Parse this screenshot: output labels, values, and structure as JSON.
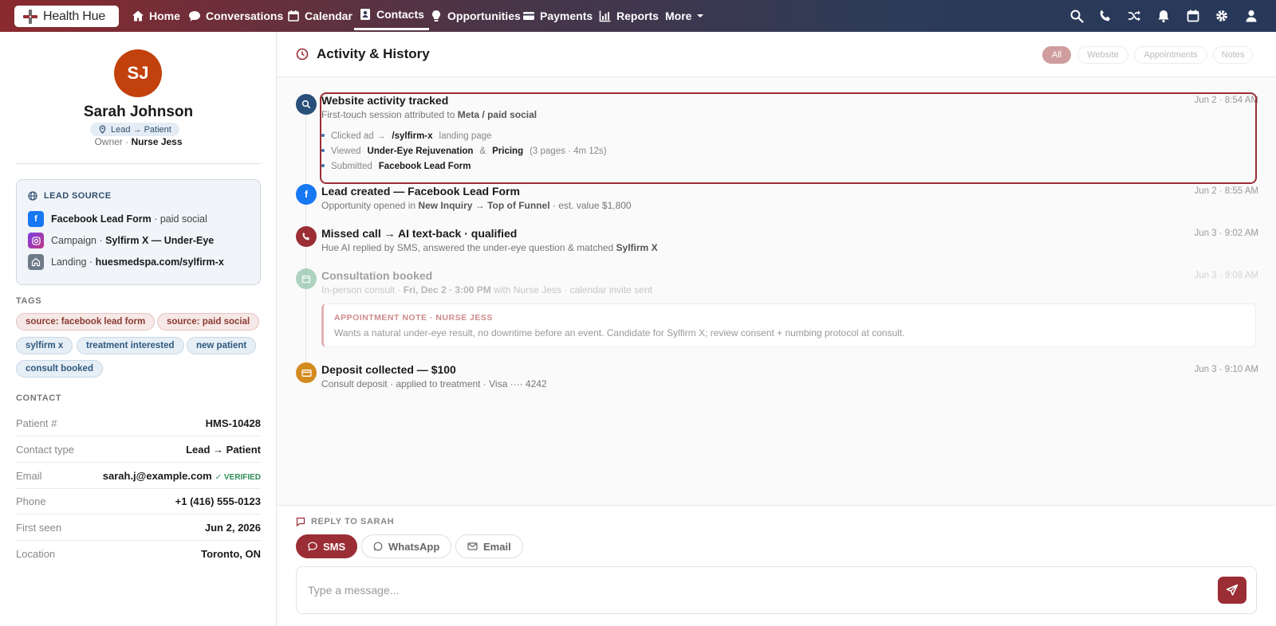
{
  "brand": {
    "name": "Health Hue",
    "accent": "#9b2d35"
  },
  "nav": {
    "items": [
      {
        "label": "Home",
        "icon": "home-icon"
      },
      {
        "label": "Conversations",
        "icon": "chat-icon"
      },
      {
        "label": "Calendar",
        "icon": "calendar-icon"
      },
      {
        "label": "Contacts",
        "icon": "contacts-icon",
        "active": true
      },
      {
        "label": "Opportunities",
        "icon": "bulb-icon"
      },
      {
        "label": "Payments",
        "icon": "card-icon"
      },
      {
        "label": "Reports",
        "icon": "chart-icon"
      },
      {
        "label": "More",
        "icon": "chevron-down-icon"
      }
    ],
    "right_icons": [
      "search-icon",
      "phone-icon",
      "shuffle-icon",
      "bell-icon",
      "calendar-icon",
      "gear-icon",
      "user-icon"
    ]
  },
  "contact": {
    "initials": "SJ",
    "name": "Sarah Johnson",
    "stage": "Lead → Patient",
    "owner_label": "Owner ·",
    "owner": "Nurse Jess"
  },
  "lead_source": {
    "heading": "LEAD SOURCE",
    "rows": [
      {
        "strong": "Facebook Lead Form",
        "rest": " · paid social",
        "icon": "facebook-icon"
      },
      {
        "pre": "Campaign · ",
        "strong": "Sylfirm X — Under-Eye",
        "icon": "instagram-icon"
      },
      {
        "pre": "Landing · ",
        "strong": "huesmedspa.com/sylfirm-x",
        "icon": "home-icon"
      }
    ]
  },
  "tags": {
    "heading": "TAGS",
    "items": [
      "source: facebook lead form",
      "source: paid social",
      "sylfirm x",
      "treatment interested",
      "new patient",
      "consult booked"
    ]
  },
  "contact_info": {
    "heading": "CONTACT",
    "rows": [
      {
        "k": "Patient #",
        "v": "HMS-10428"
      },
      {
        "k": "Contact type",
        "v": "Lead → Patient"
      },
      {
        "k": "Email",
        "v": "sarah.j@example.com",
        "badge": "✓ VERIFIED"
      },
      {
        "k": "Phone",
        "v": "+1 (416) 555-0123"
      },
      {
        "k": "First seen",
        "v": "Jun 2, 2026"
      },
      {
        "k": "Location",
        "v": "Toronto, ON"
      }
    ]
  },
  "activity": {
    "title": "Activity & History",
    "filters": [
      "All",
      "Website",
      "Appointments",
      "Notes"
    ],
    "events": [
      {
        "title": "Website activity tracked",
        "sub_pre": "First-touch session attributed to ",
        "sub_strong": "Meta / paid social",
        "time": "Jun 2 · 8:54 AM",
        "bullets": [
          {
            "a": "Clicked ad →",
            "b": "/sylfirm-x",
            "c": "landing page"
          },
          {
            "a": "Viewed",
            "b": "Under-Eye Rejuvenation",
            "c": "&",
            "d": "Pricing",
            "e": "(3 pages · 4m 12s)"
          },
          {
            "a": "Submitted",
            "b": "Facebook Lead Form"
          }
        ]
      },
      {
        "title": "Lead created — Facebook Lead Form",
        "sub_pre": "Opportunity opened in ",
        "sub_strong": "New Inquiry → Top of Funnel",
        "sub_post": " · est. value $1,800",
        "time": "Jun 2 · 8:55 AM"
      },
      {
        "title": "Missed call → AI text-back · qualified",
        "sub_pre": "Hue AI replied by SMS, answered the under-eye question & matched ",
        "sub_strong": "Sylfirm X",
        "time": "Jun 3 · 9:02 AM"
      },
      {
        "title": "Consultation booked",
        "sub_pre": "In-person consult · ",
        "sub_strong": "Fri, Dec 2 · 3:00 PM",
        "sub_post": " with Nurse Jess · calendar invite sent",
        "time": "Jun 3 · 9:08 AM",
        "note_head": "APPOINTMENT NOTE · NURSE JESS",
        "note_body": "Wants a natural under-eye result, no downtime before an event. Candidate for Sylfirm X; review consent + numbing protocol at consult."
      },
      {
        "title": "Deposit collected — $100",
        "sub_pre": "Consult deposit · applied to treatment · Visa ···· 4242",
        "time": "Jun 3 · 9:10 AM"
      }
    ]
  },
  "reply": {
    "label": "REPLY TO SARAH",
    "channels": [
      "SMS",
      "WhatsApp",
      "Email"
    ],
    "placeholder": "Type a message..."
  }
}
